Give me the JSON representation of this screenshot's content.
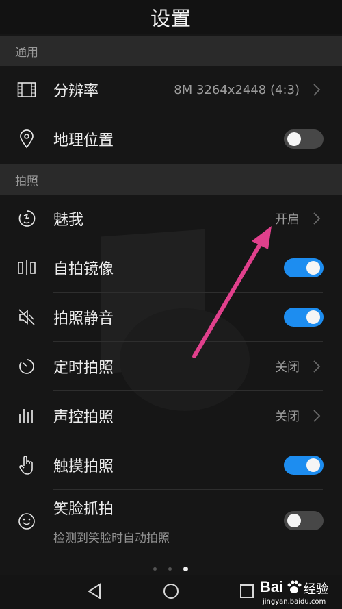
{
  "title": "设置",
  "sections": {
    "general": "通用",
    "photo": "拍照"
  },
  "rows": {
    "resolution": {
      "label": "分辨率",
      "value": "8M 3264x2448 (4:3)"
    },
    "location": {
      "label": "地理位置",
      "toggle": false
    },
    "beauty": {
      "label": "魅我",
      "value": "开启"
    },
    "mirror": {
      "label": "自拍镜像",
      "toggle": true
    },
    "mute": {
      "label": "拍照静音",
      "toggle": true
    },
    "timer": {
      "label": "定时拍照",
      "value": "关闭"
    },
    "voice": {
      "label": "声控拍照",
      "value": "关闭"
    },
    "touch": {
      "label": "触摸拍照",
      "toggle": true
    },
    "smile": {
      "label": "笑脸抓拍",
      "sublabel": "检测到笑脸时自动拍照",
      "toggle": false
    }
  },
  "pager": {
    "count": 3,
    "active": 2
  },
  "watermark": {
    "brand": "Bai",
    "brand2": "经验",
    "url": "jingyan.baidu.com"
  },
  "colors": {
    "accent": "#1d8df0",
    "arrow": "#e0408c"
  }
}
